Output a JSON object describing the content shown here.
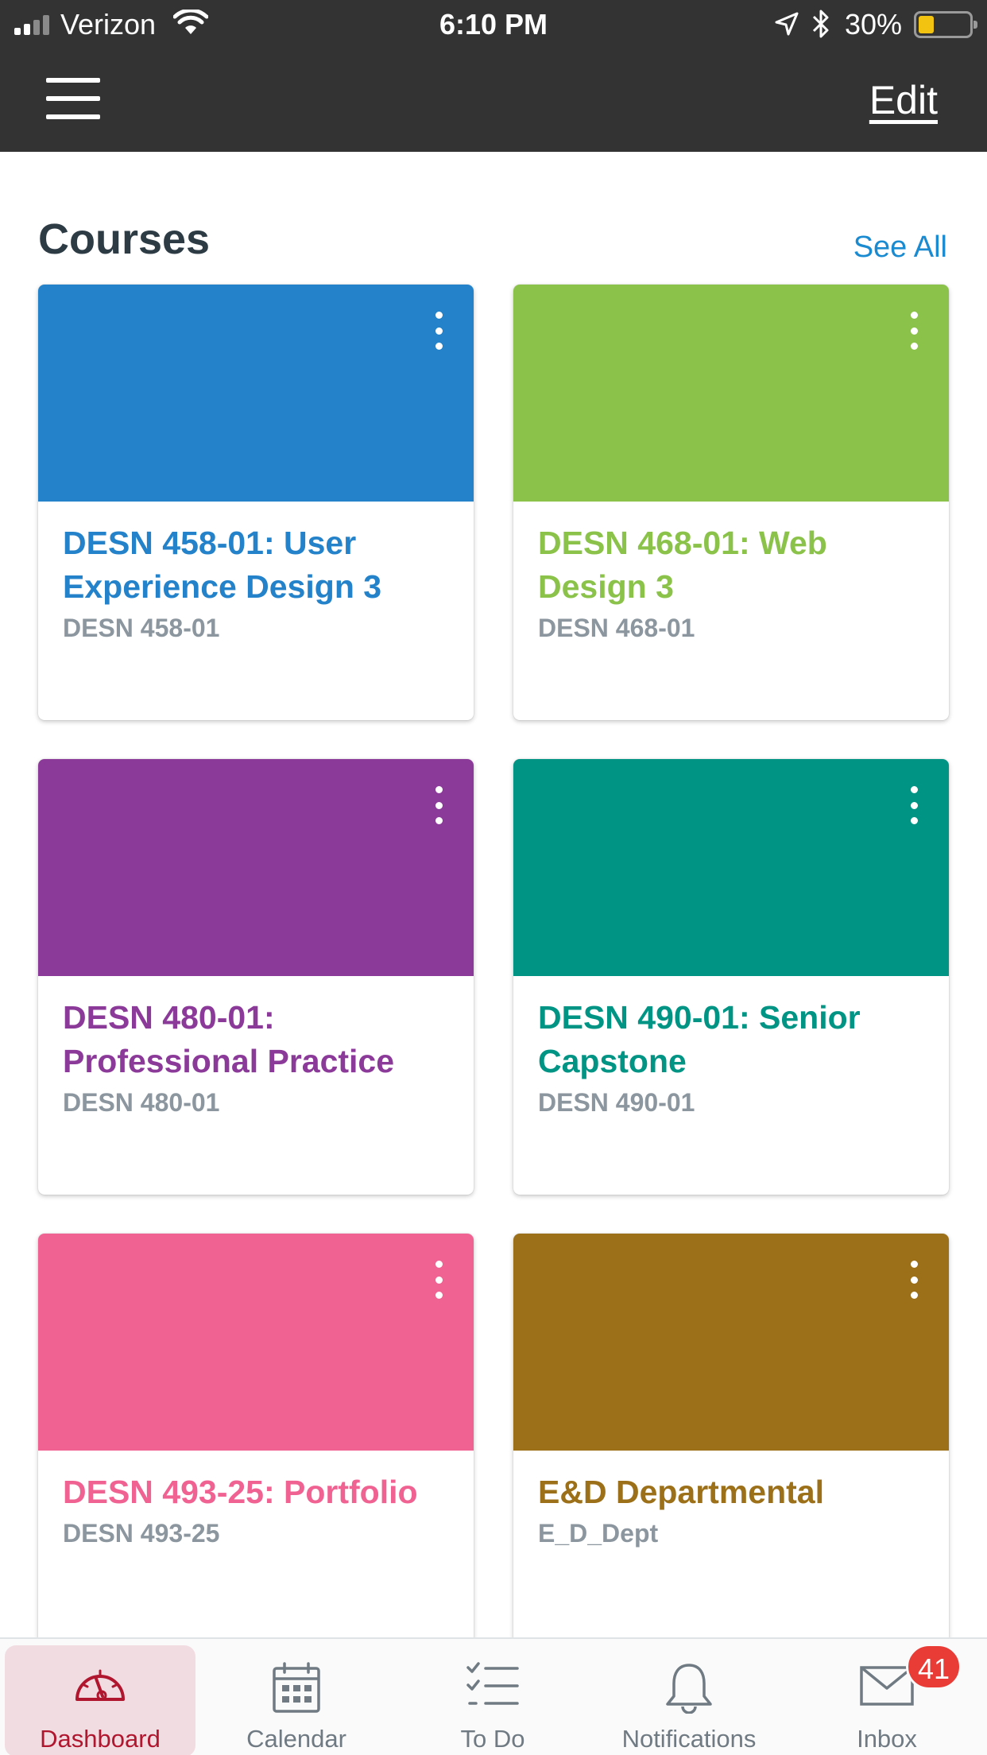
{
  "status_bar": {
    "carrier": "Verizon",
    "time": "6:10 PM",
    "battery_percent": "30%",
    "battery_level": 0.3
  },
  "nav": {
    "menu_icon": "hamburger-menu-icon",
    "edit_label": "Edit"
  },
  "courses": {
    "title": "Courses",
    "see_all": "See All",
    "items": [
      {
        "name": "DESN 458-01:  User Experience Design 3",
        "code": "DESN 458-01",
        "color": "#2382C9"
      },
      {
        "name": "DESN 468-01:  Web Design 3",
        "code": "DESN 468-01",
        "color": "#8BC34A"
      },
      {
        "name": "DESN 480-01:  Professional Practice",
        "code": "DESN 480-01",
        "color": "#8C3A99"
      },
      {
        "name": "DESN 490-01:  Senior Capstone",
        "code": "DESN 490-01",
        "color": "#009485"
      },
      {
        "name": "DESN 493-25:  Portfolio",
        "code": "DESN 493-25",
        "color": "#F06292"
      },
      {
        "name": "E&D Departmental",
        "code": "E_D_Dept",
        "color": "#9C7019"
      }
    ]
  },
  "tabs": [
    {
      "label": "Dashboard",
      "icon": "dashboard-icon",
      "active": true
    },
    {
      "label": "Calendar",
      "icon": "calendar-icon",
      "active": false
    },
    {
      "label": "To Do",
      "icon": "todo-icon",
      "active": false
    },
    {
      "label": "Notifications",
      "icon": "bell-icon",
      "active": false
    },
    {
      "label": "Inbox",
      "icon": "mail-icon",
      "active": false,
      "badge": "41"
    }
  ],
  "colors": {
    "topbar": "#333333",
    "accent": "#1a8ad1",
    "active_tab": "#b0162e",
    "badge": "#ea3c36"
  }
}
